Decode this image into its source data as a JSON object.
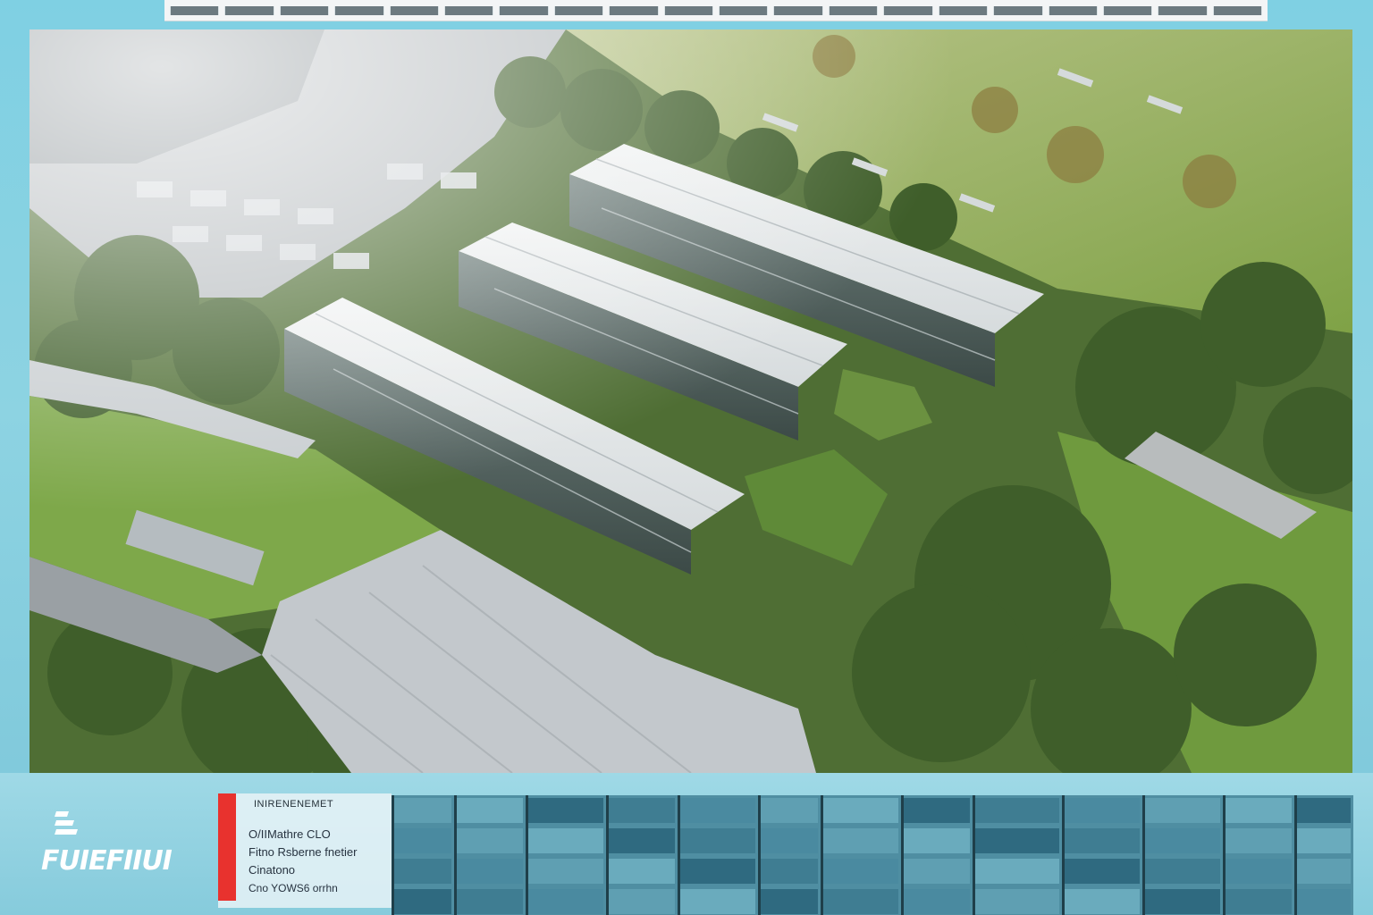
{
  "top_strip": {
    "frame_count": 20
  },
  "brand": {
    "name": "FUIEFIIUI"
  },
  "info_card": {
    "title": "INIRENENEMET",
    "line1": "O/IIMathre CLO",
    "line2": "Fitno Rsberne fnetier",
    "line3": "Cinatono",
    "line4": "Cno YOWS6 orrhn"
  },
  "colors": {
    "accent": "#e8322e",
    "band": "#86cbdc",
    "facade": "#4f8ea2"
  }
}
